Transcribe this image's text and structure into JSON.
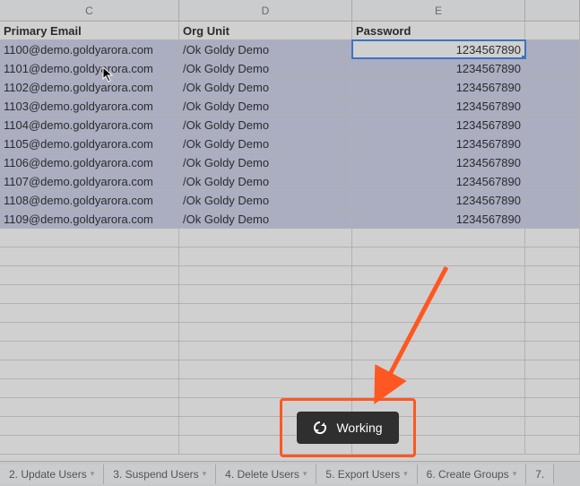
{
  "columns": {
    "c": "C",
    "d": "D",
    "e": "E"
  },
  "headers": {
    "primary_email": "Primary Email",
    "org_unit": "Org Unit",
    "password": "Password"
  },
  "rows": [
    {
      "email": "1100@demo.goldyarora.com",
      "org": "/Ok Goldy Demo",
      "pw": "1234567890"
    },
    {
      "email": "1101@demo.goldyarora.com",
      "org": "/Ok Goldy Demo",
      "pw": "1234567890"
    },
    {
      "email": "1102@demo.goldyarora.com",
      "org": "/Ok Goldy Demo",
      "pw": "1234567890"
    },
    {
      "email": "1103@demo.goldyarora.com",
      "org": "/Ok Goldy Demo",
      "pw": "1234567890"
    },
    {
      "email": "1104@demo.goldyarora.com",
      "org": "/Ok Goldy Demo",
      "pw": "1234567890"
    },
    {
      "email": "1105@demo.goldyarora.com",
      "org": "/Ok Goldy Demo",
      "pw": "1234567890"
    },
    {
      "email": "1106@demo.goldyarora.com",
      "org": "/Ok Goldy Demo",
      "pw": "1234567890"
    },
    {
      "email": "1107@demo.goldyarora.com",
      "org": "/Ok Goldy Demo",
      "pw": "1234567890"
    },
    {
      "email": "1108@demo.goldyarora.com",
      "org": "/Ok Goldy Demo",
      "pw": "1234567890"
    },
    {
      "email": "1109@demo.goldyarora.com",
      "org": "/Ok Goldy Demo",
      "pw": "1234567890"
    }
  ],
  "tabs": [
    {
      "label": "2. Update Users"
    },
    {
      "label": "3. Suspend Users"
    },
    {
      "label": "4. Delete Users"
    },
    {
      "label": "5. Export Users"
    },
    {
      "label": "6. Create Groups"
    },
    {
      "label": "7."
    }
  ],
  "toast": {
    "label": "Working"
  }
}
